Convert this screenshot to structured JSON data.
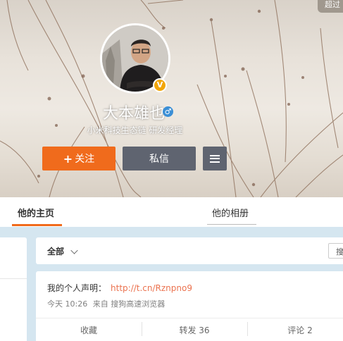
{
  "profile": {
    "name": "大本雄也",
    "gender_symbol": "♂",
    "verified_symbol": "V",
    "intro": "小米科技生态链 研发经理",
    "corner_badge": "超过"
  },
  "actions": {
    "follow_plus": "+",
    "follow_label": "关注",
    "message_label": "私信"
  },
  "tabs": [
    {
      "label": "他的主页",
      "active": true
    },
    {
      "label": "他的相册",
      "active": false
    }
  ],
  "filter": {
    "label": "全部",
    "search_placeholder": "搜"
  },
  "post": {
    "text": "我的个人声明：",
    "link": "http://t.cn/Rznpno9",
    "time": "今天 10:26",
    "from": "来自",
    "source": "搜狗高速浏览器"
  },
  "post_actions": {
    "favorite": "收藏",
    "repost": "转发 36",
    "comment": "评论 2"
  },
  "colors": {
    "follow": "#f06b1c",
    "secondary_button": "#5f6470",
    "link": "#eb7350",
    "verified": "#f2a60a",
    "gender": "#3b8fd6",
    "page_bg": "#d5e6f0"
  }
}
